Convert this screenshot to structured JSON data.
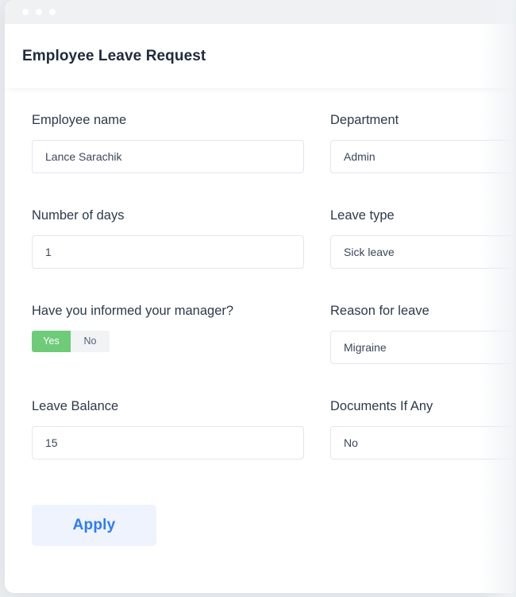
{
  "window": {
    "dots": [
      "window-dot-1",
      "window-dot-2",
      "window-dot-3"
    ]
  },
  "header": {
    "title": "Employee Leave Request"
  },
  "colors": {
    "titlebar_bg": "#f0f1f3",
    "title_text": "#202b3c",
    "input_border": "#e0e6ed",
    "toggle_on_bg": "#6ecb78",
    "toggle_off_bg": "#f2f3f5",
    "apply_bg": "#eef3fd",
    "apply_text": "#2b7cf6"
  },
  "form": {
    "fields": [
      {
        "name": "employee-name",
        "label": "Employee name",
        "type": "text",
        "value": "Lance Sarachik",
        "placeholder": "Employee name"
      },
      {
        "name": "department",
        "label": "Department",
        "type": "text",
        "value": "Admin",
        "placeholder": "Department"
      },
      {
        "name": "number-of-days",
        "label": "Number of days",
        "type": "text",
        "value": "1",
        "placeholder": "Number of days"
      },
      {
        "name": "leave-type",
        "label": "Leave type",
        "type": "text",
        "value": "Sick leave",
        "placeholder": "Leave type"
      },
      {
        "name": "informed-manager",
        "label": "Have you informed your manager?",
        "type": "segmented",
        "value": "Yes",
        "options": [
          "Yes",
          "No"
        ]
      },
      {
        "name": "reason-for-leave",
        "label": "Reason for leave",
        "type": "text",
        "value": "Migraine",
        "placeholder": "Reason for leave"
      },
      {
        "name": "leave-balance",
        "label": "Leave Balance",
        "type": "text",
        "value": "15",
        "placeholder": "Leave Balance"
      },
      {
        "name": "documents-if-any",
        "label": "Documents If Any",
        "type": "text",
        "value": "No",
        "placeholder": "Documents If Any"
      }
    ]
  },
  "actions": {
    "apply_label": "Apply"
  }
}
